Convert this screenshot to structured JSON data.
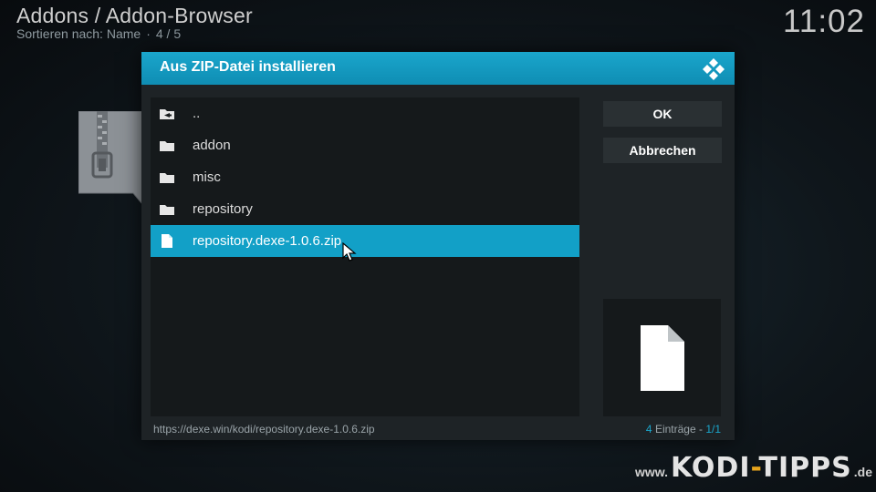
{
  "header": {
    "breadcrumb": "Addons / Addon-Browser",
    "sort_label": "Sortieren nach: Name",
    "page_info": "4 / 5",
    "clock": "11:02"
  },
  "dialog": {
    "title": "Aus ZIP-Datei installieren",
    "items": [
      {
        "label": "..",
        "icon": "folder-back-icon"
      },
      {
        "label": "addon",
        "icon": "folder-icon"
      },
      {
        "label": "misc",
        "icon": "folder-icon"
      },
      {
        "label": "repository",
        "icon": "folder-icon"
      },
      {
        "label": "repository.dexe-1.0.6.zip",
        "icon": "file-icon",
        "selected": true
      }
    ],
    "ok_label": "OK",
    "cancel_label": "Abbrechen",
    "status_path": "https://dexe.win/kodi/repository.dexe-1.0.6.zip",
    "count_number": "4",
    "count_text": " Einträge - ",
    "count_page": "1/1"
  },
  "watermark": {
    "www": "www.",
    "brand_left": "KODI",
    "brand_dash": "-",
    "brand_right": "TIPPS",
    "tld": ".de"
  },
  "colors": {
    "accent": "#12a0c7",
    "dialog_bg": "#1e2326",
    "panel_bg": "#15191b",
    "watermark_dash": "#e8a51c"
  }
}
